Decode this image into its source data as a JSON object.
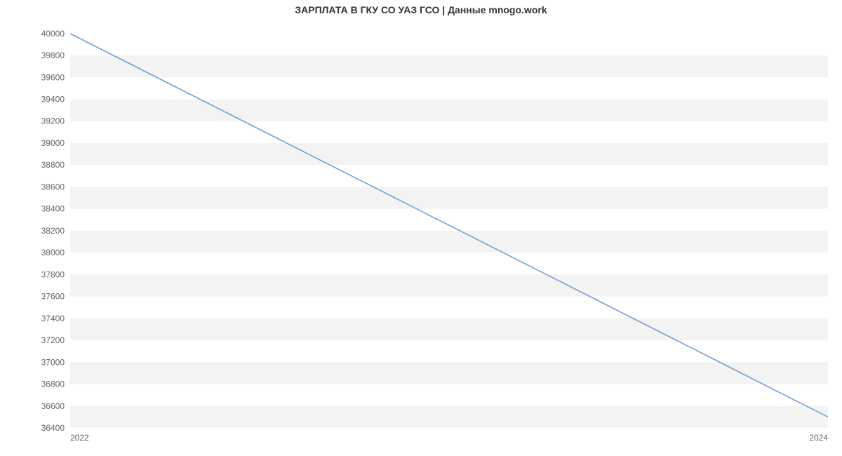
{
  "chart_data": {
    "type": "line",
    "title": "ЗАРПЛАТА В ГКУ СО УАЗ ГСО | Данные mnogo.work",
    "xlabel": "",
    "ylabel": "",
    "x": [
      2022,
      2024
    ],
    "values": [
      40000,
      36500
    ],
    "x_ticks": [
      2022,
      2024
    ],
    "y_ticks": [
      36400,
      36600,
      36800,
      37000,
      37200,
      37400,
      37600,
      37800,
      38000,
      38200,
      38400,
      38600,
      38800,
      39000,
      39200,
      39400,
      39600,
      39800,
      40000
    ],
    "ylim": [
      36400,
      40050
    ],
    "xlim": [
      2022,
      2024
    ],
    "line_color": "#6b9bd1",
    "grid_band_color": "#f3f3f3"
  }
}
